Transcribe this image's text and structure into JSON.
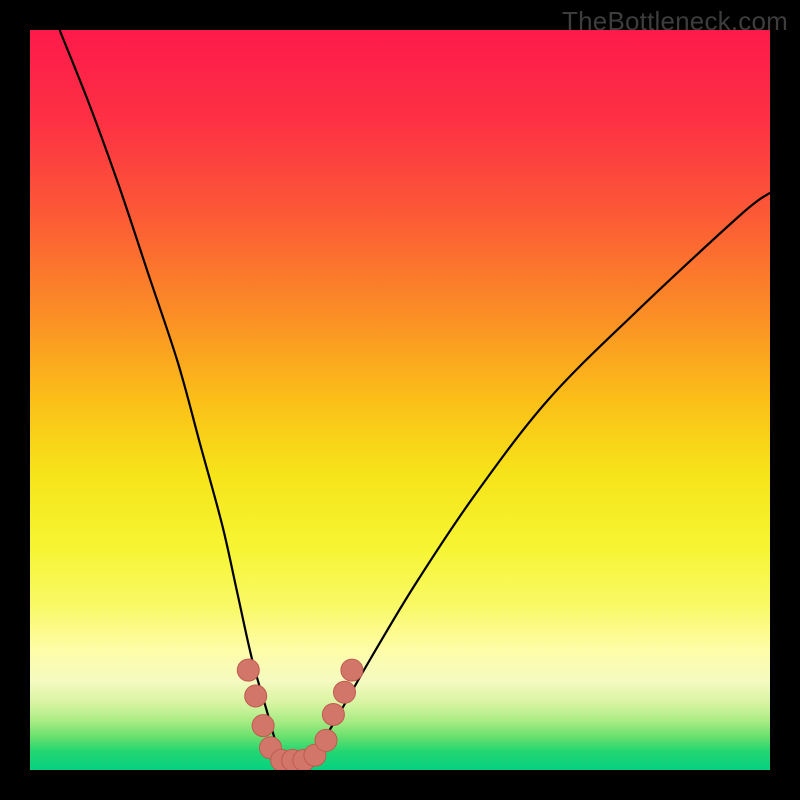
{
  "watermark": "TheBottleneck.com",
  "colors": {
    "frame": "#000000",
    "curve": "#000000",
    "dot_fill": "#d3766a",
    "dot_stroke": "#c05a4f"
  },
  "gradient_stops": [
    {
      "offset": 0.0,
      "color": "#fd1a4b"
    },
    {
      "offset": 0.12,
      "color": "#fd3044"
    },
    {
      "offset": 0.25,
      "color": "#fc5a36"
    },
    {
      "offset": 0.38,
      "color": "#fb8c26"
    },
    {
      "offset": 0.5,
      "color": "#fbbf18"
    },
    {
      "offset": 0.6,
      "color": "#f6e419"
    },
    {
      "offset": 0.7,
      "color": "#f6f533"
    },
    {
      "offset": 0.78,
      "color": "#faf968"
    },
    {
      "offset": 0.84,
      "color": "#fefdaa"
    },
    {
      "offset": 0.88,
      "color": "#f4fac0"
    },
    {
      "offset": 0.91,
      "color": "#d7f4a2"
    },
    {
      "offset": 0.935,
      "color": "#a6eb83"
    },
    {
      "offset": 0.955,
      "color": "#69e06d"
    },
    {
      "offset": 0.975,
      "color": "#23d671"
    },
    {
      "offset": 1.0,
      "color": "#05d181"
    }
  ],
  "chart_data": {
    "type": "line",
    "title": "",
    "xlabel": "",
    "ylabel": "",
    "xlim": [
      0,
      100
    ],
    "ylim": [
      0,
      100
    ],
    "series": [
      {
        "name": "bottleneck-curve",
        "x": [
          4,
          8,
          12,
          16,
          20,
          23,
          26,
          28,
          30,
          32,
          33.5,
          35,
          37,
          39,
          42,
          46,
          52,
          60,
          70,
          82,
          96,
          100
        ],
        "values": [
          100,
          90,
          79,
          67,
          55,
          44,
          33,
          24,
          15,
          8,
          3,
          1,
          1,
          3,
          8,
          15,
          25,
          37,
          50,
          62,
          75,
          78
        ]
      }
    ],
    "annotations": {
      "name": "low-band-dots",
      "points": [
        {
          "x": 29.5,
          "y": 13.5
        },
        {
          "x": 30.5,
          "y": 10.0
        },
        {
          "x": 31.5,
          "y": 6.0
        },
        {
          "x": 32.5,
          "y": 3.0
        },
        {
          "x": 34.0,
          "y": 1.3
        },
        {
          "x": 35.5,
          "y": 1.3
        },
        {
          "x": 37.0,
          "y": 1.3
        },
        {
          "x": 38.5,
          "y": 2.0
        },
        {
          "x": 40.0,
          "y": 4.0
        },
        {
          "x": 41.0,
          "y": 7.5
        },
        {
          "x": 42.5,
          "y": 10.5
        },
        {
          "x": 43.5,
          "y": 13.5
        }
      ]
    }
  }
}
